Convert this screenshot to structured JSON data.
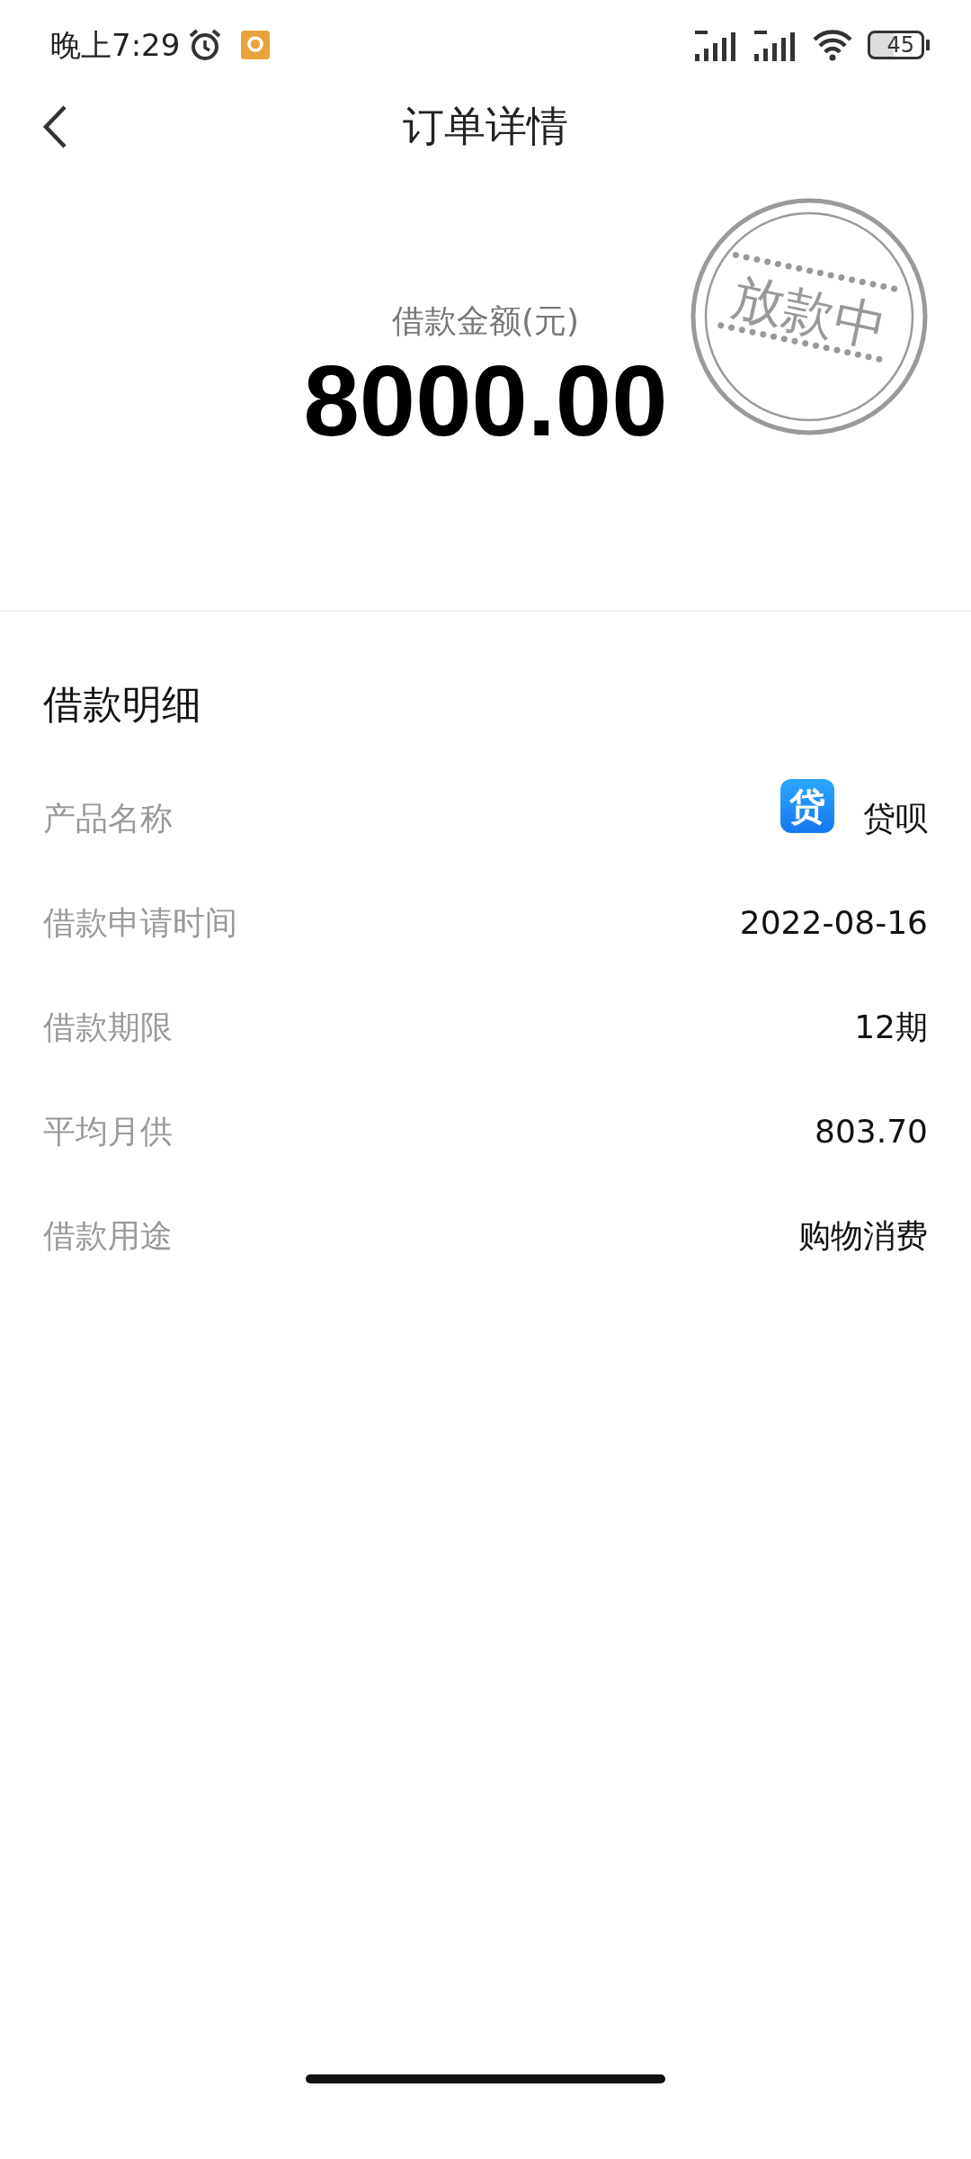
{
  "status_bar": {
    "time": "晚上7:29",
    "battery": "45"
  },
  "nav": {
    "title": "订单详情"
  },
  "summary": {
    "label": "借款金额(元)",
    "amount": "8000.00",
    "stamp": "放款中"
  },
  "details": {
    "title": "借款明细",
    "rows": [
      {
        "kind": "product",
        "label": "产品名称",
        "value": "贷呗",
        "logo_text": "贷"
      },
      {
        "kind": "text",
        "label": "借款申请时间",
        "value": "2022-08-16"
      },
      {
        "kind": "text",
        "label": "借款期限",
        "value": "12期"
      },
      {
        "kind": "text",
        "label": "平均月供",
        "value": "803.70"
      },
      {
        "kind": "text",
        "label": "借款用途",
        "value": "购物消费"
      }
    ]
  }
}
